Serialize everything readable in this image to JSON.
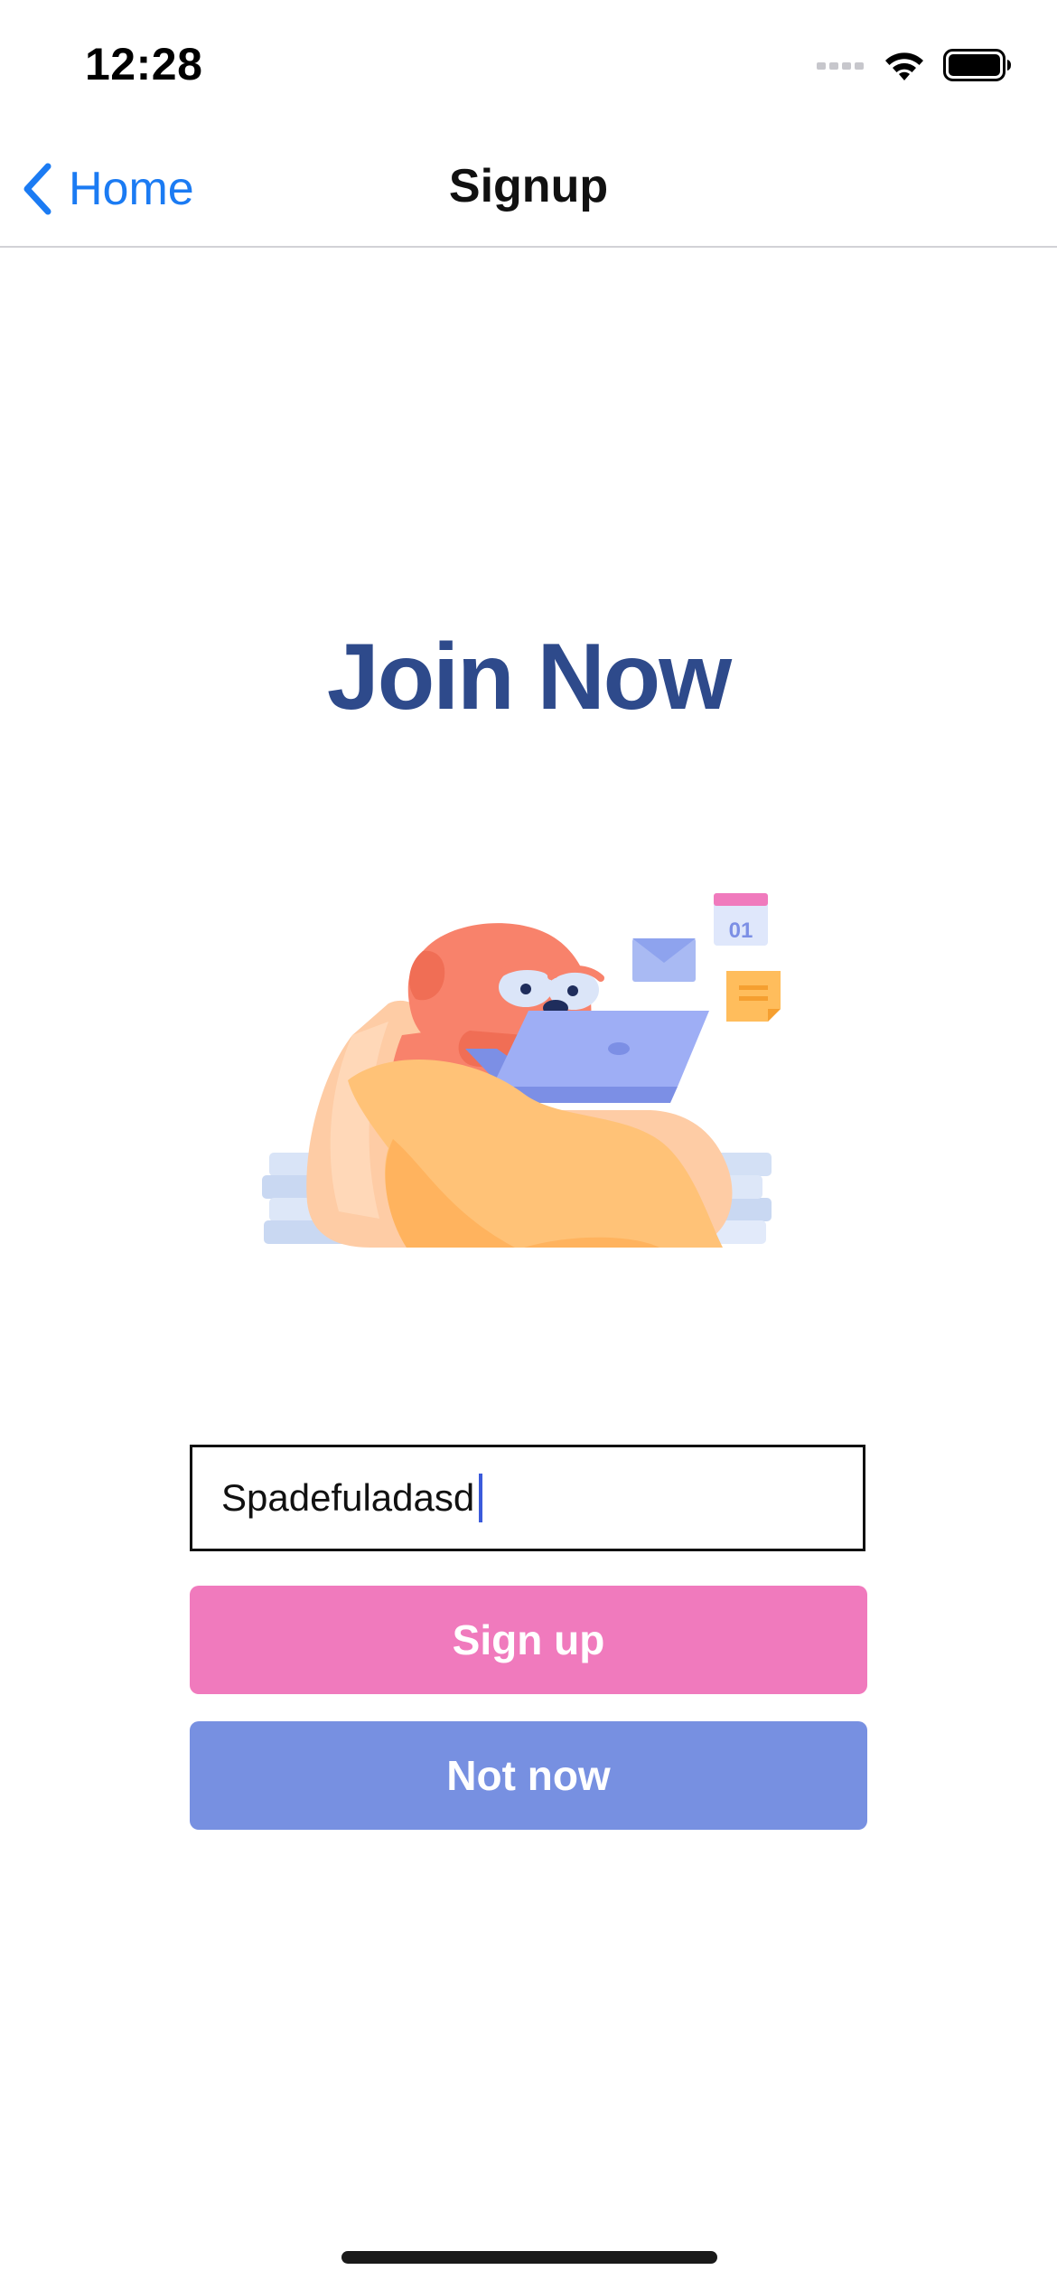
{
  "status_bar": {
    "time": "12:28"
  },
  "nav": {
    "back_label": "Home",
    "title": "Signup"
  },
  "main": {
    "heading": "Join Now",
    "name_input": {
      "value": "Spadefuladasd",
      "placeholder": ""
    },
    "signup_button": "Sign up",
    "not_now_button": "Not now",
    "illustration_calendar_text": "01"
  },
  "colors": {
    "back_link": "#1b7bf3",
    "heading": "#2e4a8b",
    "signup_button": "#f07abd",
    "not_now_button": "#7790e1"
  }
}
